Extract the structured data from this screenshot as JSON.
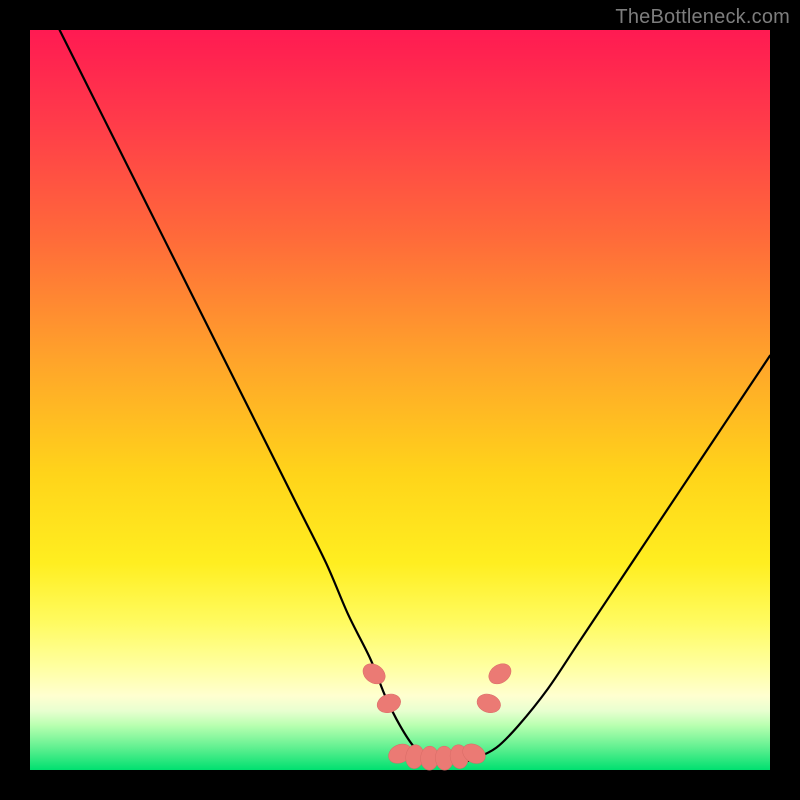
{
  "watermark": "TheBottleneck.com",
  "colors": {
    "page_bg": "#000000",
    "gradient_top": "#ff1a52",
    "gradient_bottom": "#00e070",
    "curve": "#000000",
    "marker_fill": "#eb7a74",
    "marker_stroke": "#d86b66",
    "watermark": "#7d7d7d"
  },
  "chart_data": {
    "type": "line",
    "title": "",
    "xlabel": "",
    "ylabel": "",
    "xlim": [
      0,
      100
    ],
    "ylim": [
      0,
      100
    ],
    "series": [
      {
        "name": "bottleneck-curve",
        "x": [
          4,
          8,
          12,
          16,
          20,
          24,
          28,
          32,
          36,
          40,
          43,
          46,
          48,
          50,
          52,
          54,
          56,
          58,
          60,
          63,
          66,
          70,
          74,
          78,
          82,
          86,
          90,
          94,
          98,
          100
        ],
        "y": [
          100,
          92,
          84,
          76,
          68,
          60,
          52,
          44,
          36,
          28,
          21,
          15,
          10,
          6,
          3,
          1.5,
          1,
          1,
          1.5,
          3,
          6,
          11,
          17,
          23,
          29,
          35,
          41,
          47,
          53,
          56
        ]
      }
    ],
    "markers": {
      "name": "highlight-points",
      "x": [
        46.5,
        48.5,
        50,
        52,
        54,
        56,
        58,
        60,
        62,
        63.5
      ],
      "y": [
        13,
        9,
        2.2,
        1.8,
        1.6,
        1.6,
        1.8,
        2.2,
        9,
        13
      ]
    },
    "notes": "Values estimated from pixel positions; no axis ticks or labels are present in the source image."
  }
}
